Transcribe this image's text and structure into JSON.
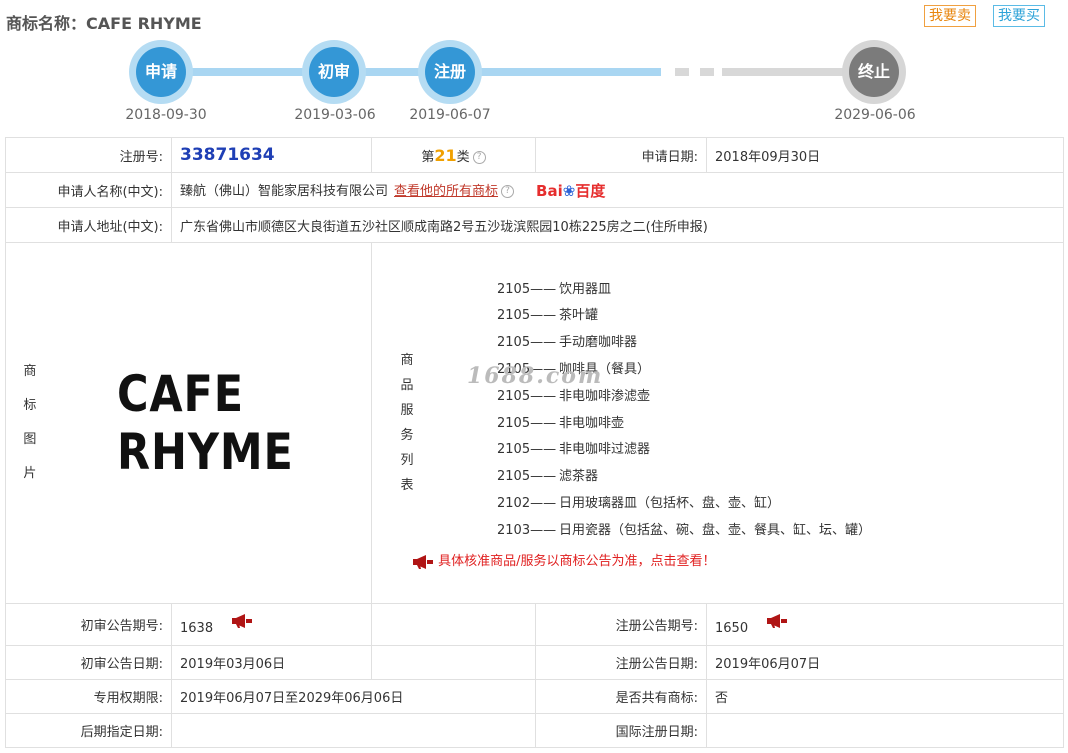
{
  "header": {
    "title_label": "商标名称：",
    "trademark_name": "CAFE RHYME",
    "sell_button": "我要卖",
    "buy_button": "我要买"
  },
  "timeline": [
    {
      "label": "申请",
      "date": "2018-09-30",
      "status": "done"
    },
    {
      "label": "初审",
      "date": "2019-03-06",
      "status": "done"
    },
    {
      "label": "注册",
      "date": "2019-06-07",
      "status": "done"
    },
    {
      "label": "终止",
      "date": "2029-06-06",
      "status": "future"
    }
  ],
  "details": {
    "reg_no_label": "注册号:",
    "reg_no": "33871634",
    "class_prefix": "第",
    "class_num": "21",
    "class_suffix": "类",
    "apply_date_label": "申请日期:",
    "apply_date": "2018年09月30日",
    "applicant_label": "申请人名称(中文):",
    "applicant": "臻航（佛山）智能家居科技有限公司",
    "all_marks_link": "查看他的所有商标",
    "baidu_text": "Bai",
    "baidu_text2": "百度",
    "address_label": "申请人地址(中文):",
    "address": "广东省佛山市顺德区大良街道五沙社区顺成南路2号五沙珑滨熙园10栋225房之二(住所申报)",
    "image_label_chars": [
      "商",
      "标",
      "图",
      "片"
    ],
    "logo_text": "CAFE RHYME",
    "goods_label_chars": [
      "商",
      "品",
      "服",
      "务",
      "列",
      "表"
    ],
    "goods": [
      {
        "code": "2105——",
        "name": "饮用器皿"
      },
      {
        "code": "2105——",
        "name": "茶叶罐"
      },
      {
        "code": "2105——",
        "name": "手动磨咖啡器"
      },
      {
        "code": "2105——",
        "name": "咖啡具（餐具）"
      },
      {
        "code": "2105——",
        "name": "非电咖啡渗滤壶"
      },
      {
        "code": "2105——",
        "name": "非电咖啡壶"
      },
      {
        "code": "2105——",
        "name": "非电咖啡过滤器"
      },
      {
        "code": "2105——",
        "name": "滤茶器"
      },
      {
        "code": "2102——",
        "name": "日用玻璃器皿（包括杯、盘、壶、缸）"
      },
      {
        "code": "2103——",
        "name": "日用瓷器（包括盆、碗、盘、壶、餐具、缸、坛、罐）"
      }
    ],
    "goods_notice": "具体核准商品/服务以商标公告为准，点击查看！",
    "watermark": "1688.com",
    "prelim_no_label": "初审公告期号:",
    "prelim_no": "1638",
    "reg_pub_no_label": "注册公告期号:",
    "reg_pub_no": "1650",
    "prelim_date_label": "初审公告日期:",
    "prelim_date": "2019年03月06日",
    "reg_pub_date_label": "注册公告日期:",
    "reg_pub_date": "2019年06月07日",
    "term_label": "专用权期限:",
    "term": "2019年06月07日至2029年06月06日",
    "shared_label": "是否共有商标:",
    "shared": "否",
    "later_date_label": "后期指定日期:",
    "later_date": "",
    "intl_date_label": "国际注册日期:",
    "intl_date": ""
  },
  "colors": {
    "accent_blue": "#3497d6",
    "node_grey": "#7b7b7b",
    "link_red": "#c0392b",
    "reg_no_blue": "#1f3fb5"
  }
}
